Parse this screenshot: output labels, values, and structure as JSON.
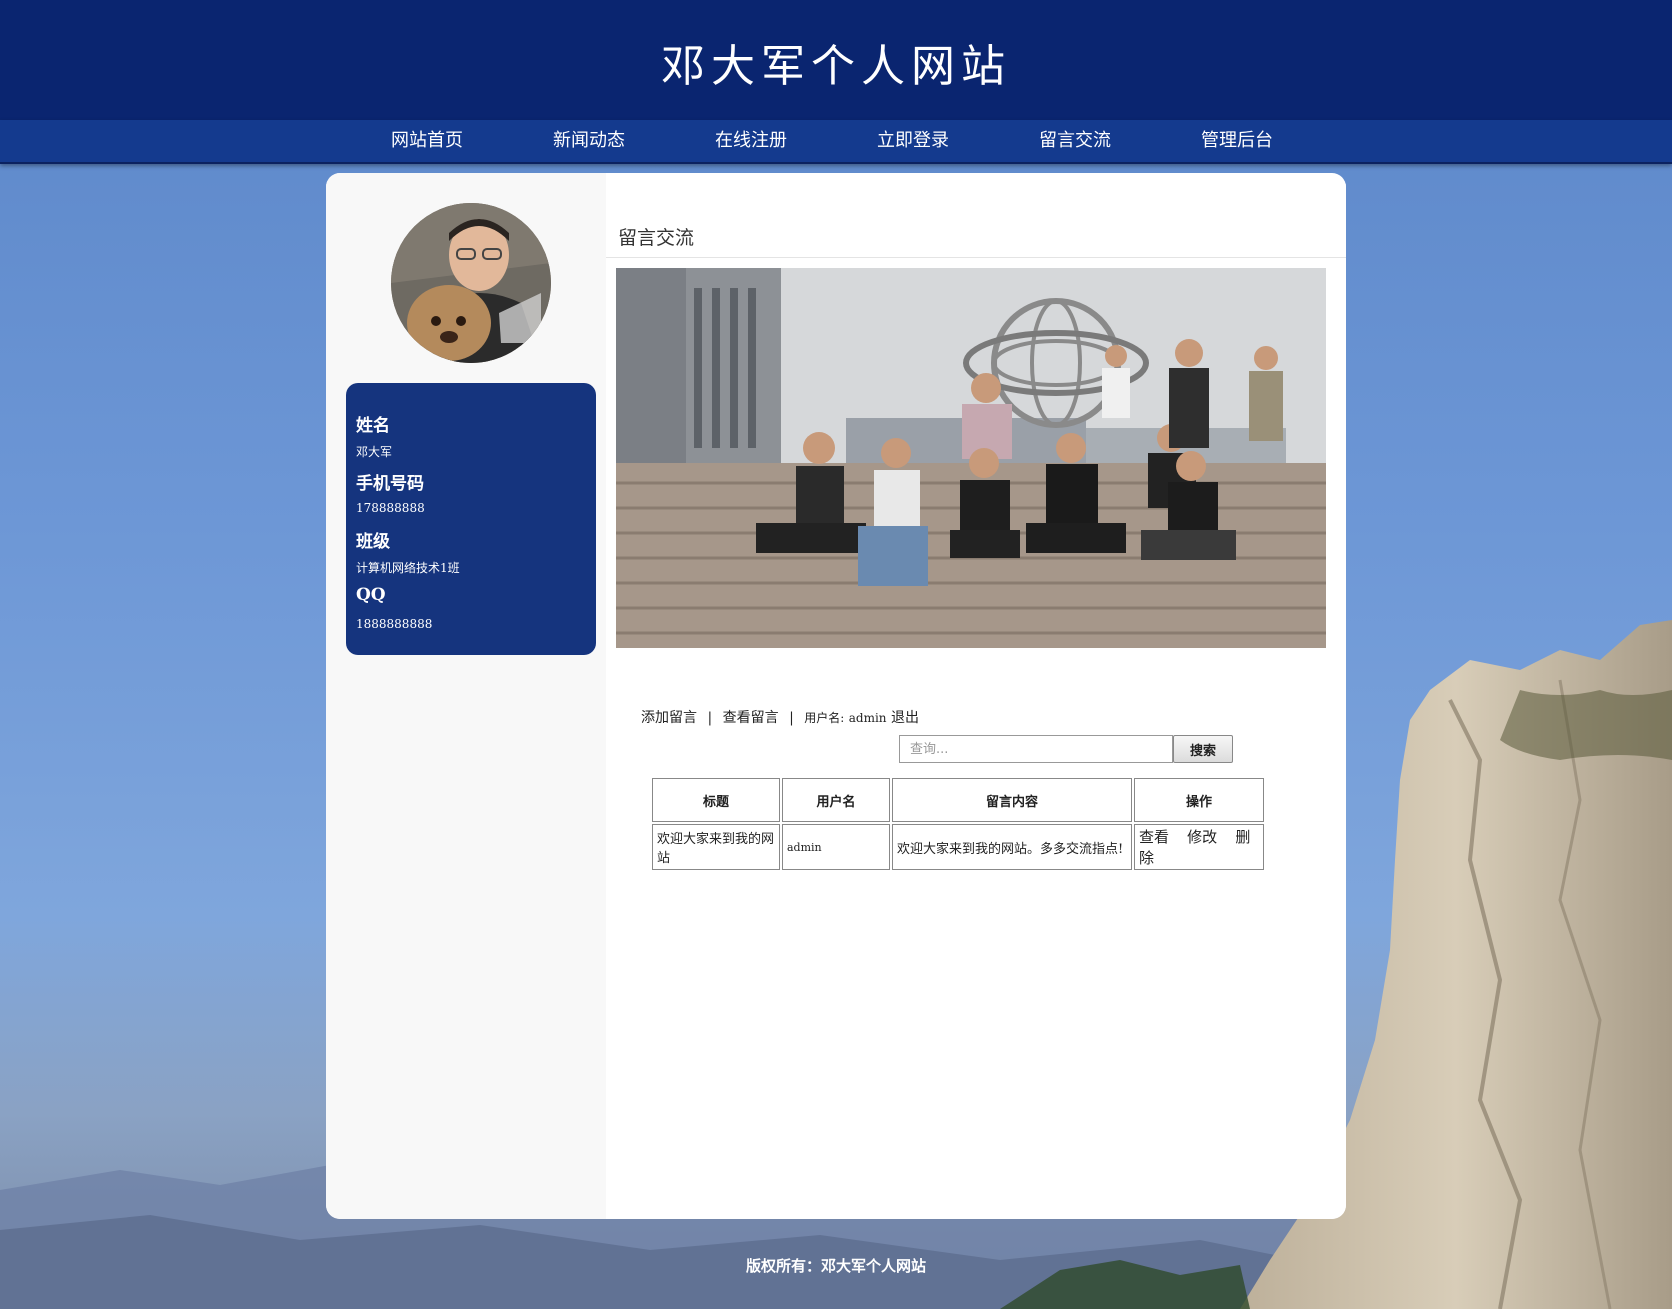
{
  "site": {
    "title": "邓大军个人网站"
  },
  "nav": {
    "items": [
      "网站首页",
      "新闻动态",
      "在线注册",
      "立即登录",
      "留言交流",
      "管理后台"
    ]
  },
  "profile": {
    "name_label": "姓名",
    "name_value": "邓大军",
    "phone_label": "手机号码",
    "phone_value": "178888888",
    "class_label": "班级",
    "class_value": "计算机网络技术1班",
    "qq_label": "QQ",
    "qq_value": "1888888888"
  },
  "main": {
    "section_title": "留言交流",
    "links": {
      "add": "添加留言",
      "sep": "|",
      "view": "查看留言",
      "user_label": "用户名:",
      "user_value": "admin",
      "logout": "退出"
    },
    "search": {
      "placeholder": "查询...",
      "button": "搜索"
    },
    "table": {
      "headers": [
        "标题",
        "用户名",
        "留言内容",
        "操作"
      ],
      "rows": [
        {
          "title": "欢迎大家来到我的网站",
          "user": "admin",
          "content": "欢迎大家来到我的网站。多多交流指点!",
          "ops": [
            "查看",
            "修改",
            "删除"
          ]
        }
      ]
    }
  },
  "footer": {
    "text": "版权所有：邓大军个人网站"
  },
  "colors": {
    "header": "#0a2570",
    "nav": "#143a8e",
    "card": "#15347e"
  }
}
